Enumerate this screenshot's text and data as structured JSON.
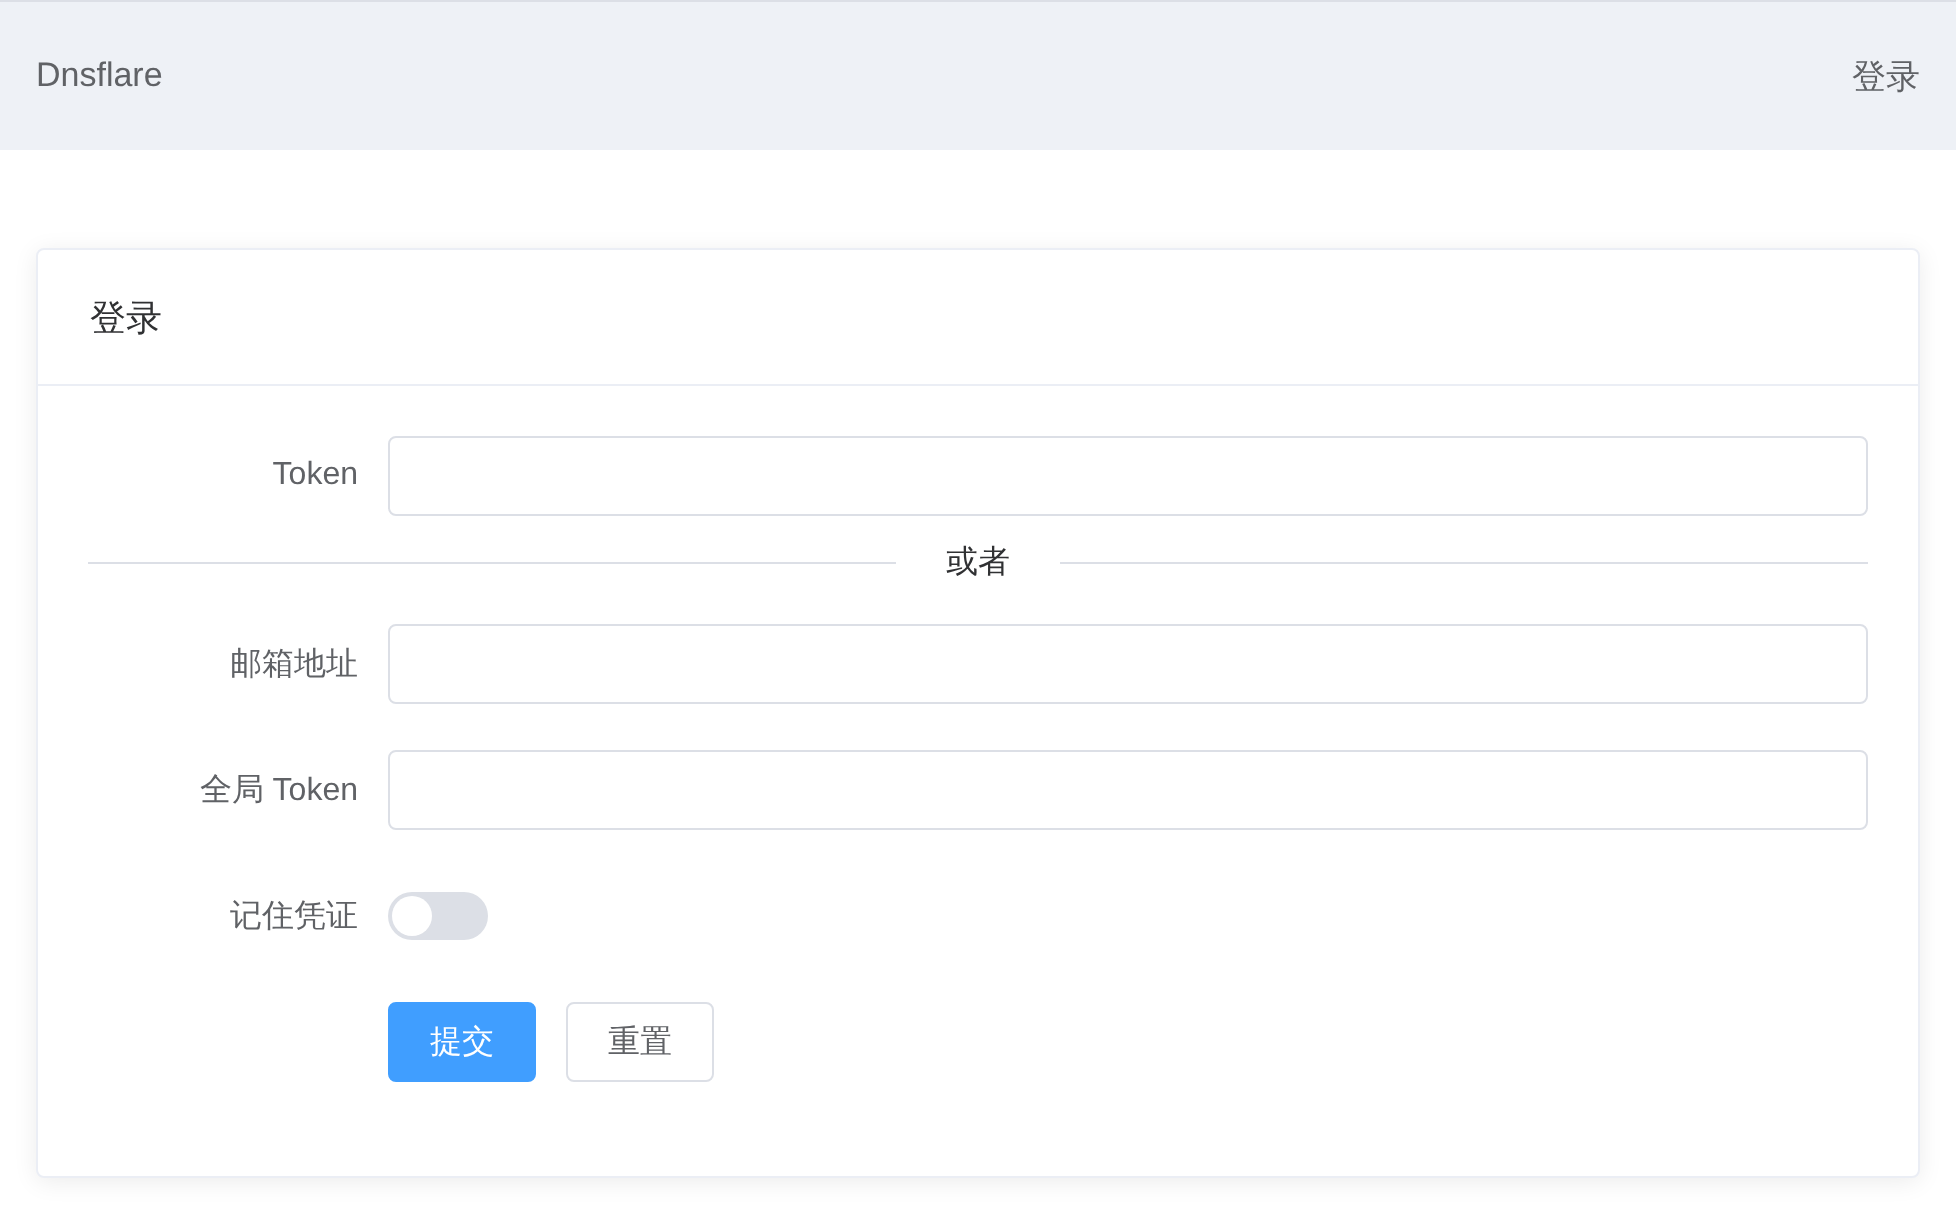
{
  "header": {
    "brand": "Dnsflare",
    "login_link": "登录"
  },
  "card": {
    "title": "登录",
    "items": [
      {
        "kind": "input",
        "label": "Token",
        "value": ""
      },
      {
        "kind": "divider",
        "label": "或者"
      },
      {
        "kind": "input",
        "label": "邮箱地址",
        "value": ""
      },
      {
        "kind": "input",
        "label": "全局 Token",
        "value": ""
      },
      {
        "kind": "switch",
        "label": "记住凭证",
        "checked": false
      }
    ],
    "buttons": [
      {
        "label": "提交",
        "primary": true
      },
      {
        "label": "重置",
        "primary": false
      }
    ]
  }
}
